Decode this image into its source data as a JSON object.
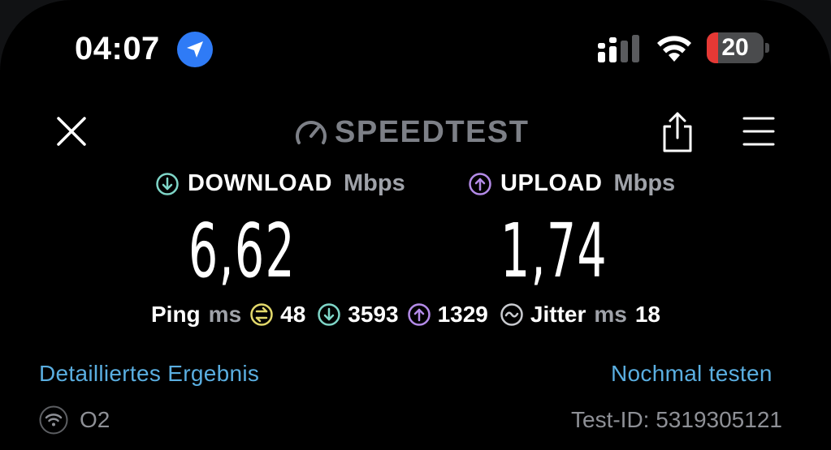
{
  "status_bar": {
    "time": "04:07",
    "battery_level": "20",
    "battery_fraction": 0.2,
    "icons": [
      "location-arrow-icon",
      "cellular-signal-icon",
      "wifi-icon",
      "battery-icon"
    ]
  },
  "header": {
    "brand": "SPEEDTEST",
    "icons": [
      "close-icon",
      "speedometer-icon",
      "share-icon",
      "menu-icon"
    ]
  },
  "download": {
    "label": "DOWNLOAD",
    "unit": "Mbps",
    "value": "6,62"
  },
  "upload": {
    "label": "UPLOAD",
    "unit": "Mbps",
    "value": "1,74"
  },
  "stats": {
    "ping_label": "Ping",
    "ping_unit": "ms",
    "ping_value": "48",
    "download_latency": "3593",
    "upload_latency": "1329",
    "jitter_label": "Jitter",
    "jitter_unit": "ms",
    "jitter_value": "18"
  },
  "links": {
    "detail": "Detailliertes Ergebnis",
    "retest": "Nochmal testen"
  },
  "footer": {
    "provider": "O2",
    "test_id": "Test-ID: 5319305121"
  },
  "colors": {
    "download_accent": "#7fd6c8",
    "upload_accent": "#b48be8",
    "ping_accent": "#e3d96b",
    "link": "#5aaee0",
    "battery_low": "#e53935",
    "location": "#2f7bf6"
  }
}
